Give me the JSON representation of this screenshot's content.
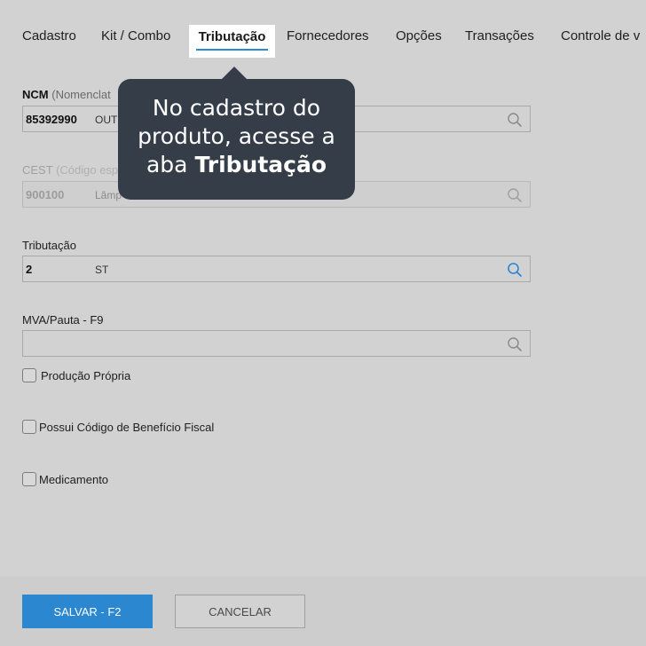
{
  "tabs": [
    {
      "label": "Cadastro"
    },
    {
      "label": "Kit / Combo"
    },
    {
      "label": "Tributação",
      "active": true
    },
    {
      "label": "Fornecedores"
    },
    {
      "label": "Opções"
    },
    {
      "label": "Transações"
    },
    {
      "label": "Controle de v"
    }
  ],
  "fields": {
    "ncm": {
      "label_bold": "NCM",
      "label_rest": "(Nomenclat",
      "code": "85392990",
      "desc": "OUTI"
    },
    "cest": {
      "label_main": "CEST",
      "label_rest": "(Código esp",
      "code": "900100",
      "desc": "Lâmp",
      "disabled": true
    },
    "tributacao": {
      "label": "Tributação",
      "code": "2",
      "desc": "ST"
    },
    "mva": {
      "label": "MVA/Pauta - F9",
      "code": "",
      "desc": ""
    }
  },
  "checkboxes": [
    {
      "label": "Produção Própria",
      "checked": false
    },
    {
      "label": "Possui Código de Benefício Fiscal",
      "checked": false
    },
    {
      "label": "Medicamento",
      "checked": false
    }
  ],
  "footer": {
    "save_label": "SALVAR - F2",
    "cancel_label": "CANCELAR"
  },
  "tooltip": {
    "line1": "No cadastro do",
    "line2": "produto, acesse a",
    "line3_prefix": "aba ",
    "line3_bold": "Tributação"
  },
  "icons": {
    "search": "search-icon"
  },
  "colors": {
    "accent": "#2a87d0",
    "tooltip_bg": "#353d49",
    "search_active": "#2b87d3",
    "search_inactive": "#8a8a8a"
  }
}
